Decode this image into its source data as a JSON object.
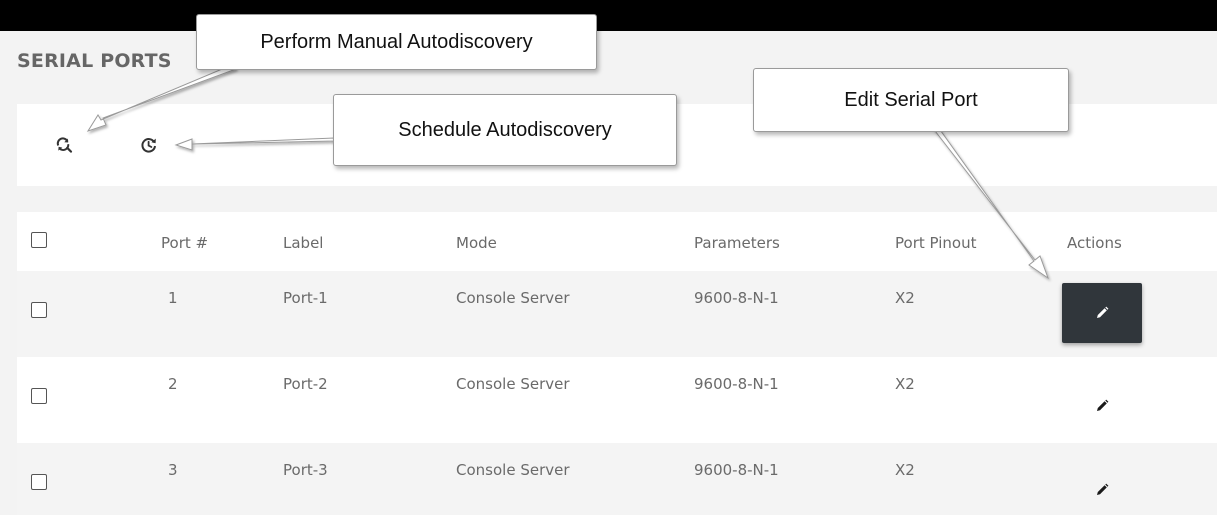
{
  "page": {
    "title": "SERIAL PORTS"
  },
  "toolbar": {
    "manual_autodiscovery_icon": "search-refresh-icon",
    "schedule_autodiscovery_icon": "clock-refresh-icon"
  },
  "table": {
    "columns": [
      "Port #",
      "Label",
      "Mode",
      "Parameters",
      "Port Pinout",
      "Actions"
    ],
    "rows": [
      {
        "port": "1",
        "label": "Port-1",
        "mode": "Console Server",
        "parameters": "9600-8-N-1",
        "pinout": "X2"
      },
      {
        "port": "2",
        "label": "Port-2",
        "mode": "Console Server",
        "parameters": "9600-8-N-1",
        "pinout": "X2"
      },
      {
        "port": "3",
        "label": "Port-3",
        "mode": "Console Server",
        "parameters": "9600-8-N-1",
        "pinout": "X2"
      }
    ],
    "edit_icon": "pencil-icon"
  },
  "callouts": {
    "manual_autodiscovery": "Perform Manual Autodiscovery",
    "schedule_autodiscovery": "Schedule Autodiscovery",
    "edit_serial_port": "Edit Serial Port"
  },
  "colors": {
    "top_bar": "#000000",
    "active_button": "#30363b",
    "page_background": "#f3f3f3"
  }
}
